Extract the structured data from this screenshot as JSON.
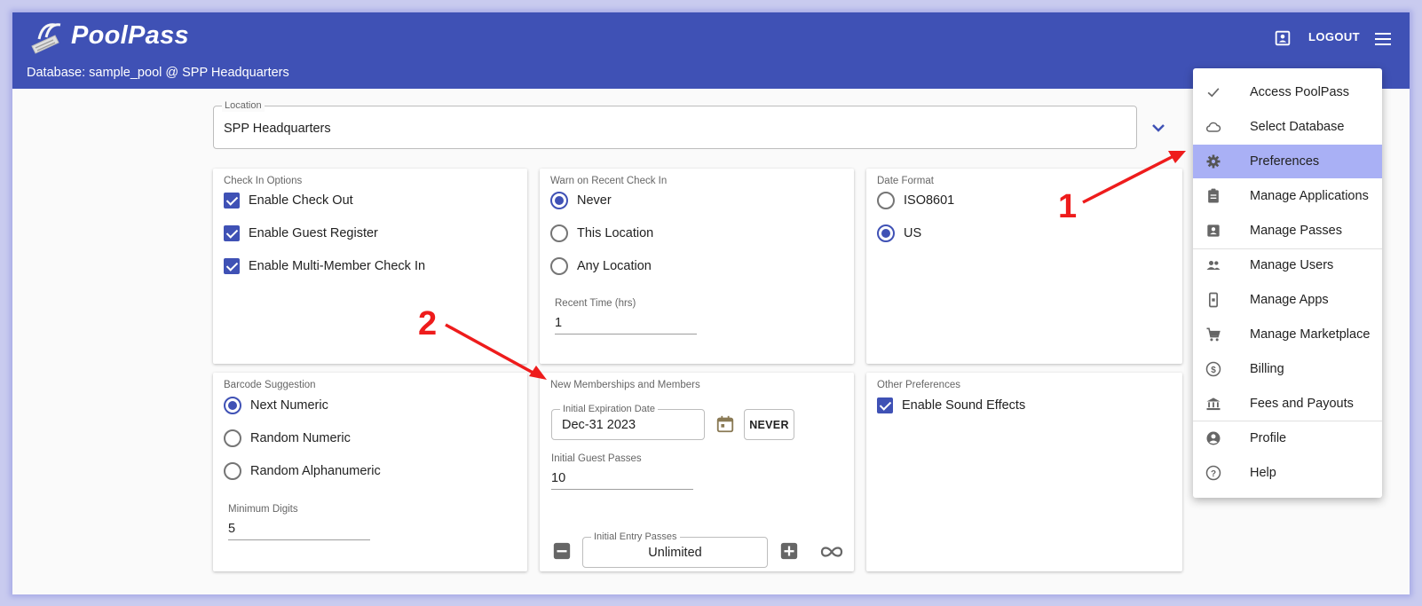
{
  "app": {
    "title": "PoolPass",
    "database_line": "Database: sample_pool @ SPP Headquarters",
    "logout_label": "LOGOUT"
  },
  "location": {
    "label": "Location",
    "value": "SPP Headquarters"
  },
  "check_in_options": {
    "title": "Check In Options",
    "items": [
      {
        "label": "Enable Check Out",
        "checked": true
      },
      {
        "label": "Enable Guest Register",
        "checked": true
      },
      {
        "label": "Enable Multi-Member Check In",
        "checked": true
      }
    ]
  },
  "warn_recent": {
    "title": "Warn on Recent Check In",
    "options": [
      {
        "label": "Never",
        "selected": true
      },
      {
        "label": "This Location",
        "selected": false
      },
      {
        "label": "Any Location",
        "selected": false
      }
    ],
    "recent_time_label": "Recent Time (hrs)",
    "recent_time_value": "1"
  },
  "date_format": {
    "title": "Date Format",
    "options": [
      {
        "label": "ISO8601",
        "selected": false
      },
      {
        "label": "US",
        "selected": true
      }
    ]
  },
  "barcode": {
    "title": "Barcode Suggestion",
    "options": [
      {
        "label": "Next Numeric",
        "selected": true
      },
      {
        "label": "Random Numeric",
        "selected": false
      },
      {
        "label": "Random Alphanumeric",
        "selected": false
      }
    ],
    "min_digits_label": "Minimum Digits",
    "min_digits_value": "5"
  },
  "new_memberships": {
    "title": "New Memberships and Members",
    "expiration_label": "Initial Expiration Date",
    "expiration_value": "Dec-31 2023",
    "never_label": "NEVER",
    "guest_passes_label": "Initial Guest Passes",
    "guest_passes_value": "10",
    "entry_passes_label": "Initial Entry Passes",
    "entry_passes_value": "Unlimited"
  },
  "other_prefs": {
    "title": "Other Preferences",
    "items": [
      {
        "label": "Enable Sound Effects",
        "checked": true
      }
    ]
  },
  "menu": {
    "items": [
      {
        "label": "Access PoolPass",
        "icon": "check-icon"
      },
      {
        "label": "Select Database",
        "icon": "cloud-icon"
      },
      {
        "label": "Preferences",
        "icon": "gear-icon",
        "active": true
      },
      {
        "label": "Manage Applications",
        "icon": "clipboard-icon"
      },
      {
        "label": "Manage Passes",
        "icon": "badge-icon"
      },
      {
        "label": "Manage Users",
        "icon": "people-icon"
      },
      {
        "label": "Manage Apps",
        "icon": "phone-icon"
      },
      {
        "label": "Manage Marketplace",
        "icon": "cart-icon"
      },
      {
        "label": "Billing",
        "icon": "dollar-icon"
      },
      {
        "label": "Fees and Payouts",
        "icon": "bank-icon"
      },
      {
        "label": "Profile",
        "icon": "account-circle-icon"
      },
      {
        "label": "Help",
        "icon": "help-icon"
      }
    ]
  },
  "annotations": {
    "marker_1": "1",
    "marker_2": "2"
  },
  "colors": {
    "primary": "#3f51b5",
    "menu_active": "#a9b0f5",
    "annotation": "#ee1c1c"
  }
}
